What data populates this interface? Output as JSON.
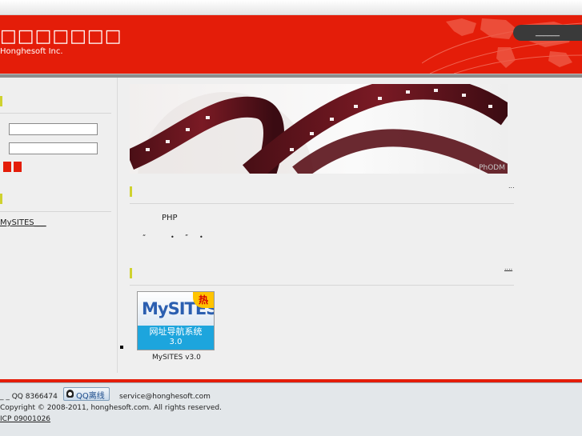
{
  "header": {
    "logo_main": "□□□□□□□",
    "logo_sub": "Honghesoft Inc.",
    "nav_button": "______"
  },
  "sidebar": {
    "link": "MySITES___"
  },
  "banner": {
    "watermark": "PhODM"
  },
  "main": {
    "more_top": "...",
    "intro_text": "PHP",
    "quote_left": "“",
    "dot1": "•",
    "quote_right": "”",
    "dot2": "•",
    "more_products": "....",
    "product": {
      "logo": "MySITES",
      "hot_badge": "热",
      "cn_title": "网址导航系统",
      "version_badge": "3.0",
      "caption": "MySITES v3.0"
    }
  },
  "footer": {
    "qq_text": "_ _ QQ 8366474",
    "qq_button": "QQ离线",
    "email": "service@honghesoft.com",
    "copyright": "Copyright © 2008-2011, honghesoft.com. All rights reserved.",
    "icp": " ICP 09001026 "
  },
  "colors": {
    "brand_red": "#e41d09",
    "accent_bar": "#cfd230",
    "product_blue": "#1da5dd"
  }
}
